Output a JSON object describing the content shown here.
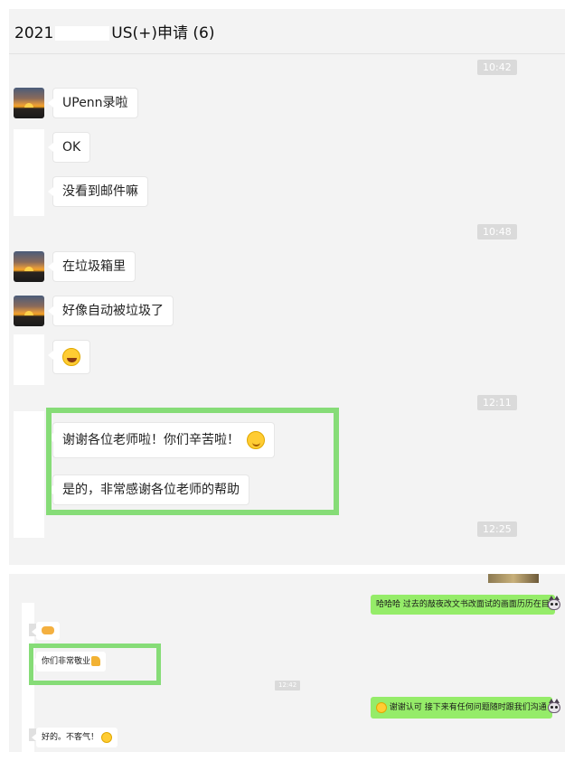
{
  "chat": {
    "title_prefix": "2021",
    "title_suffix": "US(+)申请 (6)"
  },
  "timestamps": {
    "t1": "10:42",
    "t2": "10:48",
    "t3": "12:11",
    "t4": "12:25",
    "t5": "12:42"
  },
  "messages": [
    {
      "text": "UPenn录啦"
    },
    {
      "text": "OK"
    },
    {
      "text": "没看到邮件嘛"
    },
    {
      "text": "在垃圾箱里"
    },
    {
      "text": "好像自动被垃圾了"
    },
    {
      "text": ""
    },
    {
      "text": "谢谢各位老师啦！你们辛苦啦！"
    },
    {
      "text": "是的，非常感谢各位老师的帮助"
    }
  ],
  "emoji_names": [
    "laughing-tears-icon",
    "smiling-face-icon"
  ],
  "lower": {
    "sent1": "哈哈哈 过去的敲夜改文书改面试的画面历历在目",
    "recv_handshake": "",
    "recv1": "你们非常敬业",
    "sent2": "谢谢认可  接下来有任何问题随时跟我们沟通",
    "recv2": "好的。不客气！"
  },
  "colors": {
    "highlight": "#86dc77",
    "sent_bubble": "#95ec69",
    "panel_bg": "#f3f3f3"
  }
}
